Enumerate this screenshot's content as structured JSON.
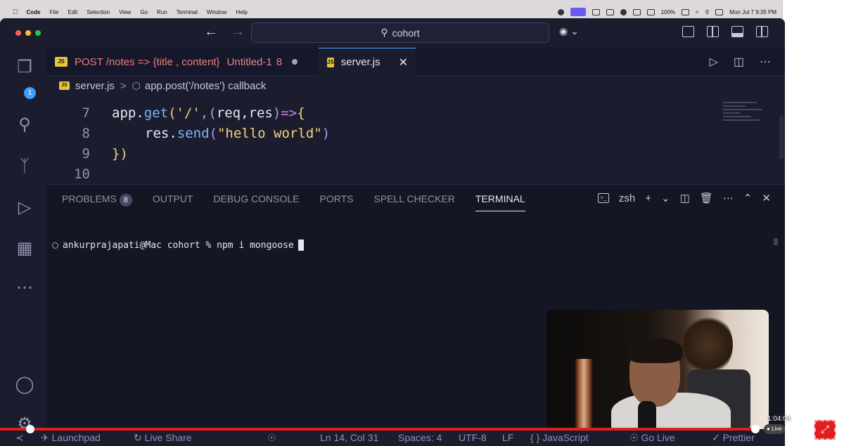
{
  "menubar": {
    "app": "Code",
    "items": [
      "File",
      "Edit",
      "Selection",
      "View",
      "Go",
      "Run",
      "Terminal",
      "Window",
      "Help"
    ],
    "battery": "100%",
    "clock": "Mon Jul 7  9:35 PM"
  },
  "titlebar": {
    "search": "cohort"
  },
  "activity": {
    "explorer_badge": "1"
  },
  "tabs": [
    {
      "icon": "JS",
      "label": "POST /notes => {title , content}",
      "modified_label": "Untitled-1",
      "count": "8"
    },
    {
      "icon": "JS",
      "label": "server.js",
      "close": "✕"
    }
  ],
  "breadcrumb": {
    "file": "server.js",
    "separator": ">",
    "symbol": "app.post('/notes') callback"
  },
  "editor": {
    "lines": [
      {
        "n": "7",
        "tokens": [
          "app.",
          "get",
          "(",
          "'/'",
          ",(",
          "req,res",
          ")",
          "=>",
          "{"
        ]
      },
      {
        "n": "8",
        "tokens": [
          "res.",
          "send",
          "(",
          "\"hello world\"",
          ")"
        ]
      },
      {
        "n": "9",
        "tokens": [
          "}",
          ")"
        ]
      },
      {
        "n": "10",
        "tokens": []
      }
    ]
  },
  "panel": {
    "tabs": [
      "PROBLEMS",
      "OUTPUT",
      "DEBUG CONSOLE",
      "PORTS",
      "SPELL CHECKER",
      "TERMINAL"
    ],
    "problems_count": "8",
    "shell": "zsh",
    "terminal_line": "ankurprajapati@Mac cohort % npm i mongoose"
  },
  "statusbar": {
    "launchpad": "Launchpad",
    "liveshare": "Live Share",
    "position": "Ln 14, Col 31",
    "spaces": "Spaces: 4",
    "encoding": "UTF-8",
    "eol": "LF",
    "language": "JavaScript",
    "golive": "Go Live",
    "prettier": "Prettier"
  },
  "video": {
    "time": "1:04:04",
    "live": "Live"
  },
  "colors": {
    "accent": "#e01e1e",
    "editor_bg": "#1b1d2e",
    "modified_tab": "#f07c7c"
  }
}
